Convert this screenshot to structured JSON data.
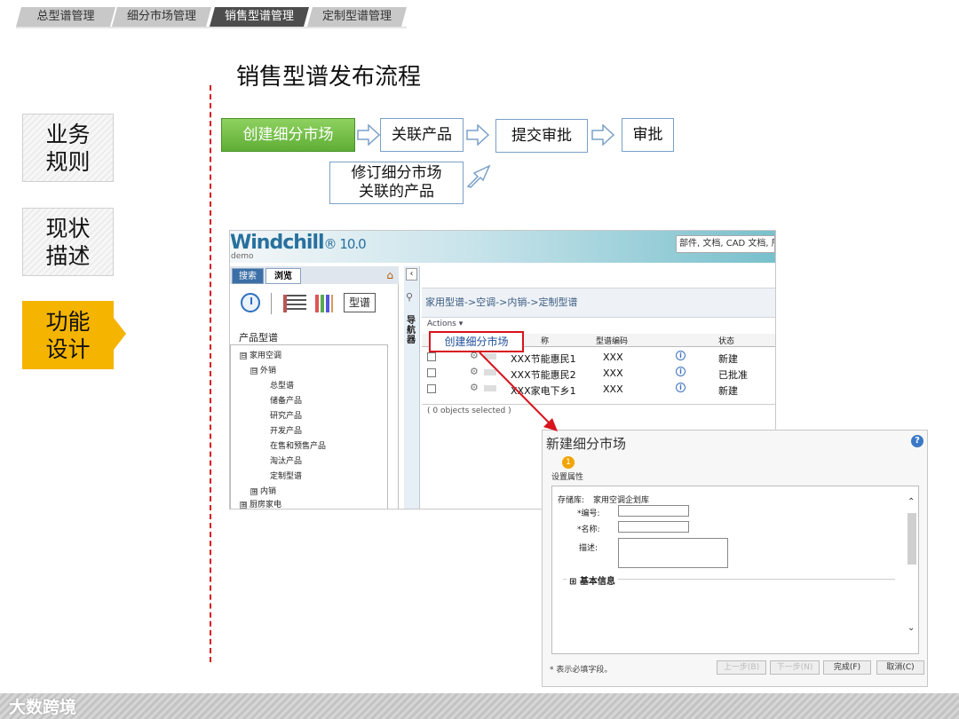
{
  "top_tabs": [
    {
      "label": "总型谱管理"
    },
    {
      "label": "细分市场管理"
    },
    {
      "label": "销售型谱管理",
      "active": true
    },
    {
      "label": "定制型谱管理"
    }
  ],
  "side_nav": [
    {
      "label": "业务\n规则"
    },
    {
      "label": "现状\n描述"
    },
    {
      "label": "功能\n设计",
      "active": true
    }
  ],
  "page_title": "销售型谱发布流程",
  "flow": {
    "step1": "创建细分市场",
    "step2": "关联产品",
    "step3": "提交审批",
    "step4": "审批",
    "revise": "修订细分市场\n关联的产品"
  },
  "windchill": {
    "logo": "Windchill",
    "version": "10.0",
    "sub": "demo",
    "search_placeholder": "部件, 文档, CAD 文档, 所",
    "tab_search": "搜索",
    "tab_browse": "浏览",
    "type_button": "型谱",
    "tree_title": "产品型谱",
    "tree": [
      {
        "label": "家用空调",
        "toggle": "⊟"
      },
      {
        "label": "外销",
        "toggle": "⊟"
      },
      {
        "label": "总型谱"
      },
      {
        "label": "储备产品"
      },
      {
        "label": "研究产品"
      },
      {
        "label": "开发产品"
      },
      {
        "label": "在售和预售产品"
      },
      {
        "label": "淘汰产品"
      },
      {
        "label": "定制型谱"
      },
      {
        "label": "内销",
        "toggle": "⊞"
      },
      {
        "label": "厨房家电",
        "toggle": "⊞"
      }
    ],
    "nav_label": "导航器",
    "breadcrumb": "家用型谱->空调->内销->定制型谱",
    "actions": "Actions ▾",
    "columns": {
      "name": "称",
      "code": "型谱编码",
      "status": "状态"
    },
    "rows": [
      {
        "name": "XXX节能惠民1",
        "code": "XXX",
        "status": "新建"
      },
      {
        "name": "XXX节能惠民2",
        "code": "XXX",
        "status": "已批准"
      },
      {
        "name": "XXX家电下乡1",
        "code": "XXX",
        "status": "新建"
      }
    ],
    "selected_count": "( 0 objects selected )",
    "create_callout": "创建细分市场"
  },
  "dialog": {
    "title": "新建细分市场",
    "step_label": "设置属性",
    "repository_label": "存储库:",
    "repository_value": "家用空调企划库",
    "number_label": "*编号:",
    "name_label": "*名称:",
    "desc_label": "描述:",
    "section_label": "基本信息",
    "required_note": "* 表示必填字段。",
    "buttons": [
      "上一步(B)",
      "下一步(N)",
      "完成(F)",
      "取消(C)"
    ]
  },
  "brand": "大数跨境",
  "colors": {
    "accent": "#f4b400",
    "red": "#d8141e",
    "green": "#5fae35"
  }
}
